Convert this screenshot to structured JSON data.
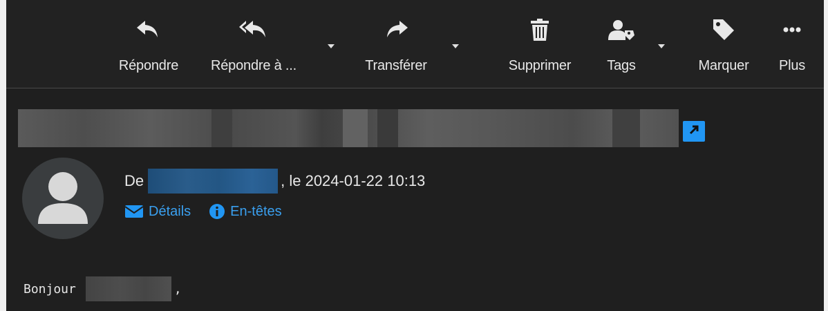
{
  "toolbar": {
    "reply": "Répondre",
    "reply_all": "Répondre à ...",
    "forward": "Transférer",
    "delete": "Supprimer",
    "tags": "Tags",
    "mark": "Marquer",
    "more": "Plus"
  },
  "message": {
    "from_prefix": "De",
    "date_suffix": ", le 2024-01-22 10:13",
    "details_link": "Détails",
    "headers_link": "En-têtes",
    "greeting": "Bonjour",
    "greeting_end": ","
  },
  "icons": {
    "reply": "reply-icon",
    "reply_all": "reply-all-icon",
    "forward": "forward-icon",
    "delete": "trash-icon",
    "tags": "user-tag-icon",
    "mark": "tag-icon",
    "more": "ellipsis-icon",
    "open_external": "external-link-icon",
    "details": "envelope-icon",
    "headers": "info-icon"
  },
  "colors": {
    "accent": "#2196f3",
    "link": "#3aa0f0",
    "background": "#1f1f1f"
  }
}
